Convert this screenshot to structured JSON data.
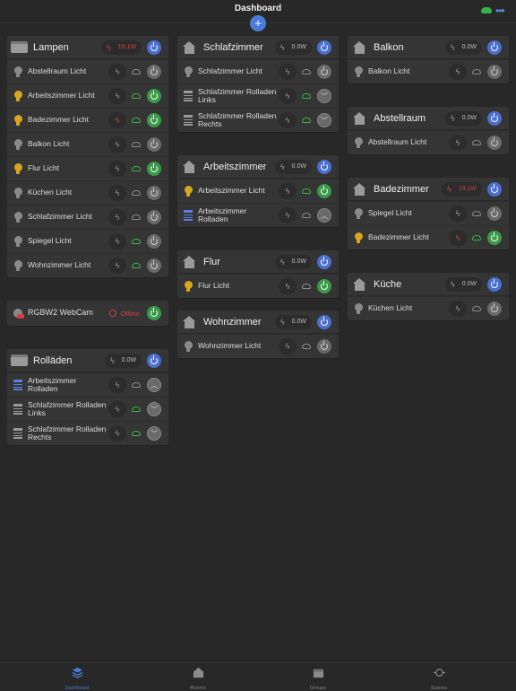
{
  "app": {
    "title": "Dashboard"
  },
  "colors": {
    "accent": "#4a7bd8",
    "on_green": "#3a9a4a",
    "bulb_on": "#d9a520",
    "alert_red": "#d04040",
    "cloud_green": "#3ab24a"
  },
  "groups": {
    "lampen": {
      "title": "Lampen",
      "power": "19.1W",
      "items": [
        {
          "label": "Abstellraum Licht"
        },
        {
          "label": "Arbeitszimmer Licht"
        },
        {
          "label": "Badezimmer Licht"
        },
        {
          "label": "Balkon Licht"
        },
        {
          "label": "Flur Licht"
        },
        {
          "label": "Küchen Licht"
        },
        {
          "label": "Schlafzimmer Licht"
        },
        {
          "label": "Spiegel Licht"
        },
        {
          "label": "Wohnzimmer Licht"
        }
      ]
    },
    "webcam": {
      "label": "RGBW2 WebCam",
      "status": "Offline"
    },
    "rolladen": {
      "title": "Rolläden",
      "power": "0.0W",
      "items": [
        {
          "label": "Arbeitszimmer Rolladen"
        },
        {
          "label": "Schlafzimmer Rolladen Links"
        },
        {
          "label": "Schlafzimmer Rolladen Rechts"
        }
      ]
    }
  },
  "rooms": {
    "schlafzimmer": {
      "title": "Schlafzimmer",
      "power": "0.0W",
      "items": [
        {
          "label": "Schlafzimmer Licht"
        },
        {
          "label": "Schlafzimmer Rolladen Links"
        },
        {
          "label": "Schlafzimmer Rolladen Rechts"
        }
      ]
    },
    "arbeitszimmer": {
      "title": "Arbeitszimmer",
      "power": "0.0W",
      "items": [
        {
          "label": "Arbeitszimmer Licht"
        },
        {
          "label": "Arbeitszimmer Rolladen"
        }
      ]
    },
    "flur": {
      "title": "Flur",
      "power": "0.0W",
      "items": [
        {
          "label": "Flur Licht"
        }
      ]
    },
    "wohnzimmer": {
      "title": "Wohnzimmer",
      "power": "0.0W",
      "items": [
        {
          "label": "Wohnzimmer Licht"
        }
      ]
    },
    "balkon": {
      "title": "Balkon",
      "power": "0.0W",
      "items": [
        {
          "label": "Balkon Licht"
        }
      ]
    },
    "abstellraum": {
      "title": "Abstellraum",
      "power": "0.0W",
      "items": [
        {
          "label": "Abstellraum Licht"
        }
      ]
    },
    "badezimmer": {
      "title": "Badezimmer",
      "power": "19.1W",
      "items": [
        {
          "label": "Spiegel Licht"
        },
        {
          "label": "Badezimmer Licht"
        }
      ]
    },
    "kueche": {
      "title": "Küche",
      "power": "0.0W",
      "items": [
        {
          "label": "Küchen Licht"
        }
      ]
    }
  },
  "tabs": [
    {
      "label": "Dashboard",
      "icon": "layers-icon"
    },
    {
      "label": "Rooms",
      "icon": "house-icon"
    },
    {
      "label": "Groups",
      "icon": "box-icon"
    },
    {
      "label": "Scenes",
      "icon": "scene-icon"
    }
  ]
}
